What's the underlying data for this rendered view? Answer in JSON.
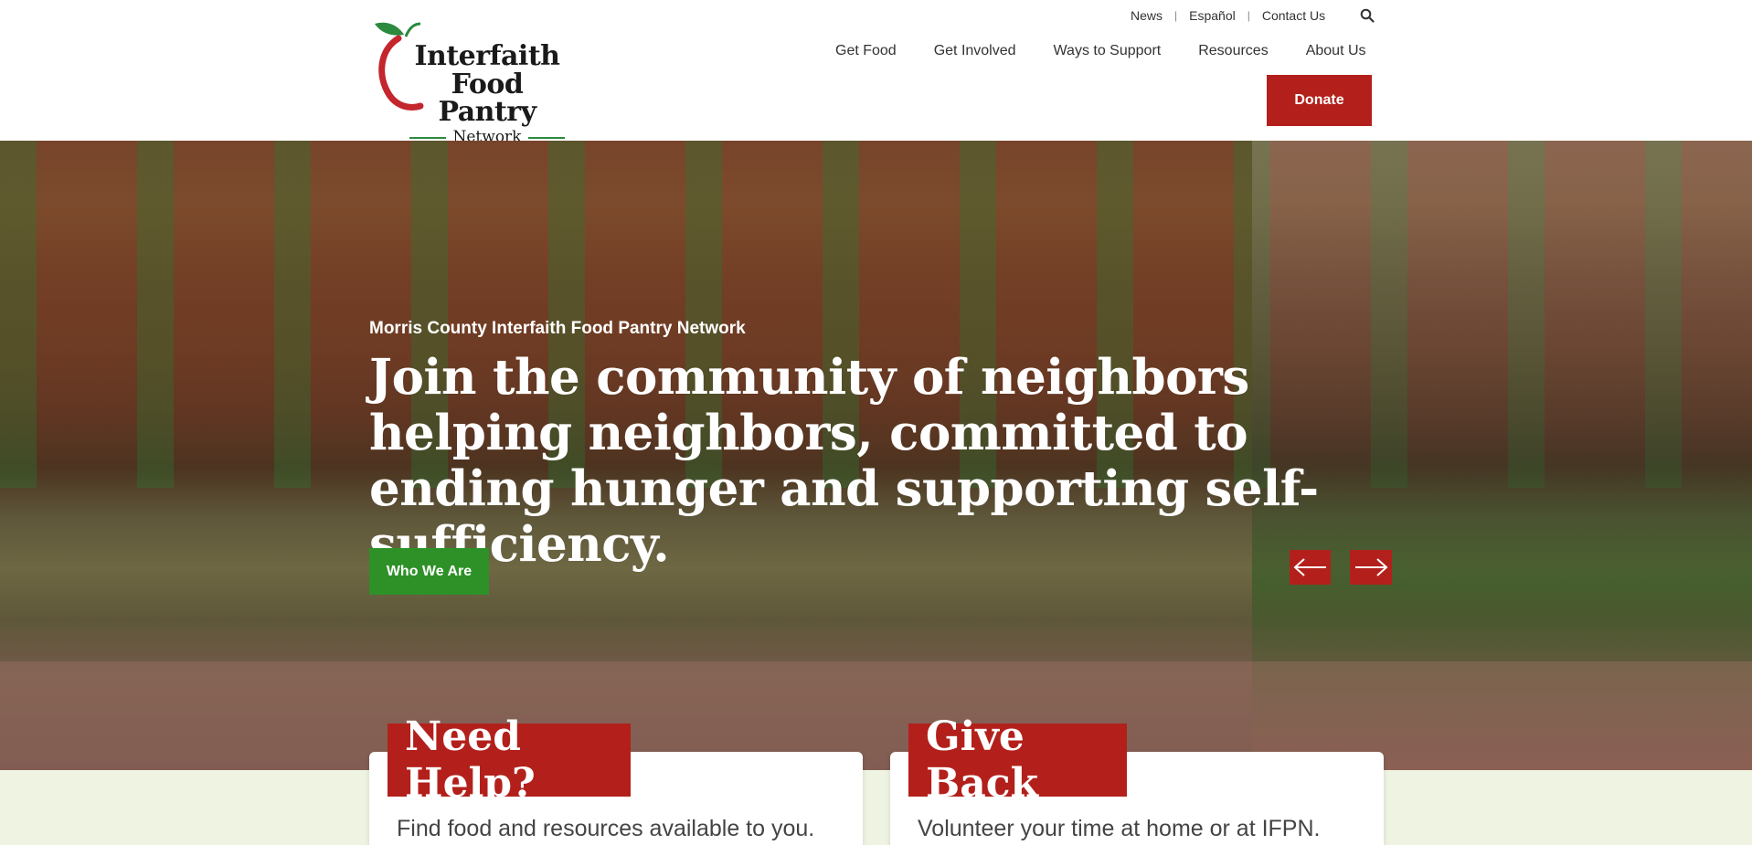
{
  "logo": {
    "line1": "Interfaith",
    "line2": "Food Pantry",
    "line3": "Network",
    "icon": "apple-logo-icon"
  },
  "utility_nav": {
    "news": "News",
    "sep1": "|",
    "espanol": "Español",
    "sep2": "|",
    "contact": "Contact Us",
    "search_icon": "search-icon"
  },
  "main_nav": {
    "items": [
      {
        "label": "Get Food"
      },
      {
        "label": "Get Involved"
      },
      {
        "label": "Ways to Support"
      },
      {
        "label": "Resources"
      },
      {
        "label": "About Us"
      }
    ],
    "donate": "Donate"
  },
  "hero": {
    "kicker": "Morris County Interfaith Food Pantry Network",
    "title": "Join the community of neighbors helping neighbors, committed to ending hunger and supporting self-sufficiency.",
    "cta": "Who We Are",
    "prev_icon": "arrow-left-icon",
    "next_icon": "arrow-right-icon"
  },
  "cards": [
    {
      "title": "Need Help?",
      "text": "Find food and resources available to you."
    },
    {
      "title": "Give Back",
      "text": "Volunteer your time at home or at IFPN."
    }
  ],
  "colors": {
    "brand_red": "#b3201b",
    "brand_green": "#2e9128",
    "lower_bg": "#eef3e2"
  }
}
